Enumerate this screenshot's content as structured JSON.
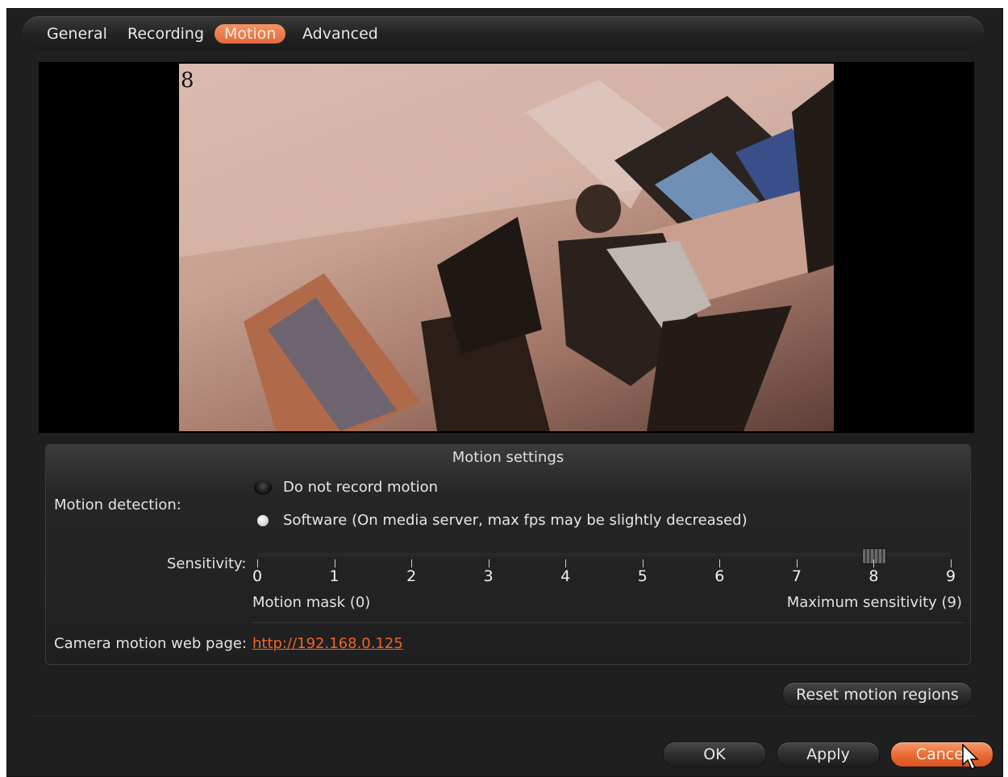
{
  "tabs": [
    {
      "label": "General",
      "active": false
    },
    {
      "label": "Recording",
      "active": false
    },
    {
      "label": "Motion",
      "active": true
    },
    {
      "label": "Advanced",
      "active": false
    }
  ],
  "video": {
    "frame_number": "8"
  },
  "motion_settings": {
    "title": "Motion settings",
    "detection_label": "Motion detection:",
    "options": [
      {
        "label": "Do not record motion",
        "selected": false
      },
      {
        "label": "Software (On media server, max fps may be slightly decreased)",
        "selected": true
      }
    ],
    "sensitivity_label": "Sensitivity:",
    "sensitivity_ticks": [
      "0",
      "1",
      "2",
      "3",
      "4",
      "5",
      "6",
      "7",
      "8",
      "9"
    ],
    "sensitivity_value": 8,
    "min_caption": "Motion mask (0)",
    "max_caption": "Maximum sensitivity (9)",
    "web_page_label": "Camera motion web page:",
    "web_page_url": "http://192.168.0.125"
  },
  "buttons": {
    "reset": "Reset motion regions",
    "ok": "OK",
    "apply": "Apply",
    "cancel": "Cancel"
  },
  "colors": {
    "accent": "#e8652e",
    "link": "#f0642a",
    "background": "#1f1f1f"
  }
}
